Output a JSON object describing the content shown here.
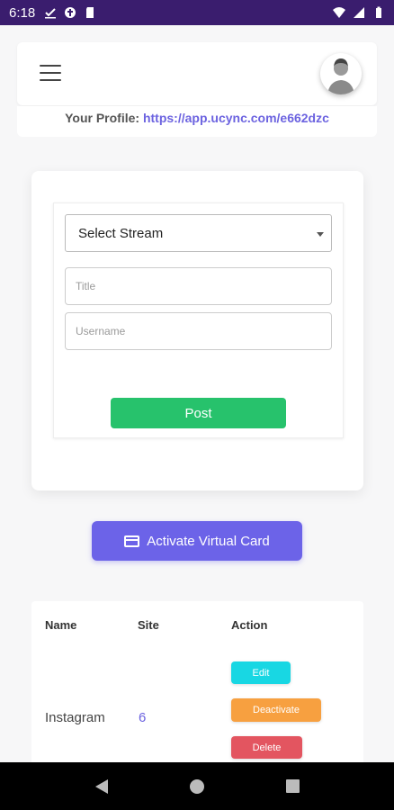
{
  "status_bar": {
    "time": "6:18",
    "icons_left": [
      "check-icon",
      "data-saver-icon",
      "sd-card-icon"
    ],
    "icons_right": [
      "wifi-icon",
      "signal-icon",
      "battery-icon"
    ],
    "background": "#3a1d6e"
  },
  "header": {
    "menu_icon": "hamburger-menu-icon",
    "avatar_icon": "user-avatar-icon"
  },
  "profile": {
    "label": "Your Profile:",
    "link": "https://app.ucync.com/e662dzc"
  },
  "form": {
    "stream_select": "Select Stream",
    "title_placeholder": "Title",
    "username_placeholder": "Username",
    "post_label": "Post"
  },
  "virtual_card": {
    "label": "Activate Virtual Card",
    "icon": "credit-card-icon"
  },
  "table": {
    "headers": [
      "Name",
      "Site",
      "Action"
    ],
    "rows": [
      {
        "name": "Instagram",
        "site": "6",
        "actions": [
          "Edit",
          "Deactivate",
          "Delete"
        ]
      }
    ]
  },
  "colors": {
    "accent": "#6c63e8",
    "post": "#27c26c",
    "edit": "#18d7e3",
    "deactivate": "#f7a040",
    "delete": "#e35560"
  }
}
